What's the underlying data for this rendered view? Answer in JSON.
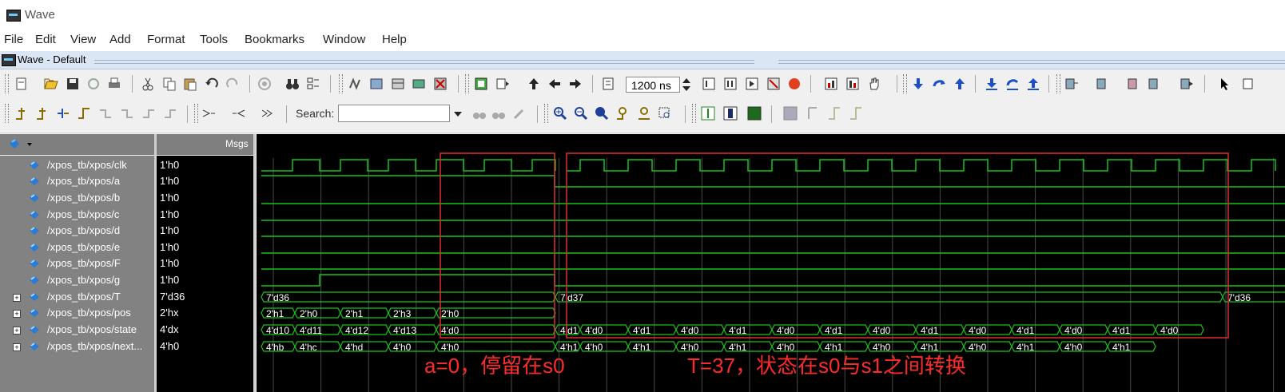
{
  "window": {
    "title": "Wave"
  },
  "menu": [
    "File",
    "Edit",
    "View",
    "Add",
    "Format",
    "Tools",
    "Bookmarks",
    "Window",
    "Help"
  ],
  "subwindow": {
    "title": "Wave - Default"
  },
  "toolbar": {
    "time_value": "1200 ns",
    "search_label": "Search:",
    "search_value": ""
  },
  "panel": {
    "msgs_label": "Msgs"
  },
  "signals": [
    {
      "name": "/xpos_tb/xpos/clk",
      "value": "1'h0",
      "kind": "bit",
      "expandable": false
    },
    {
      "name": "/xpos_tb/xpos/a",
      "value": "1'h0",
      "kind": "bit",
      "expandable": false
    },
    {
      "name": "/xpos_tb/xpos/b",
      "value": "1'h0",
      "kind": "bit",
      "expandable": false
    },
    {
      "name": "/xpos_tb/xpos/c",
      "value": "1'h0",
      "kind": "bit",
      "expandable": false
    },
    {
      "name": "/xpos_tb/xpos/d",
      "value": "1'h0",
      "kind": "bit",
      "expandable": false
    },
    {
      "name": "/xpos_tb/xpos/e",
      "value": "1'h0",
      "kind": "bit",
      "expandable": false
    },
    {
      "name": "/xpos_tb/xpos/F",
      "value": "1'h0",
      "kind": "bit",
      "expandable": false
    },
    {
      "name": "/xpos_tb/xpos/g",
      "value": "1'h0",
      "kind": "bit",
      "expandable": false
    },
    {
      "name": "/xpos_tb/xpos/T",
      "value": "7'd36",
      "kind": "bus",
      "expandable": true
    },
    {
      "name": "/xpos_tb/xpos/pos",
      "value": "2'hx",
      "kind": "bus",
      "expandable": true
    },
    {
      "name": "/xpos_tb/xpos/state",
      "value": "4'dx",
      "kind": "bus",
      "expandable": true
    },
    {
      "name": "/xpos_tb/xpos/next...",
      "value": "4'h0",
      "kind": "bus",
      "expandable": true
    }
  ],
  "bus_values": {
    "T": [
      "7'd36",
      "7'd37",
      "7'd36"
    ],
    "pos": [
      "2'h1",
      "2'h0",
      "2'h1",
      "2'h3",
      "2'h0"
    ],
    "state": [
      "4'd10",
      "4'd11",
      "4'd12",
      "4'd13",
      "4'd0",
      "4'd1",
      "4'd0",
      "4'd1",
      "4'd0",
      "4'd1",
      "4'd0",
      "4'd1",
      "4'd0",
      "4'd1",
      "4'd0",
      "4'd1",
      "4'd0",
      "4'd1",
      "4'd0"
    ],
    "next": [
      "4'hb",
      "4'hc",
      "4'hd",
      "4'h0",
      "4'h0",
      "4'h1",
      "4'h0",
      "4'h1",
      "4'h0",
      "4'h1",
      "4'h0",
      "4'h1",
      "4'h0",
      "4'h1",
      "4'h0",
      "4'h1",
      "4'h0",
      "4'h1"
    ]
  },
  "annotations": {
    "left": "a=0，停留在s0",
    "right": "T=37，状态在s0与s1之间转换"
  },
  "colors": {
    "wave": "#19c319",
    "annotation": "#ff2a2a",
    "value_text": "#ffffff"
  }
}
